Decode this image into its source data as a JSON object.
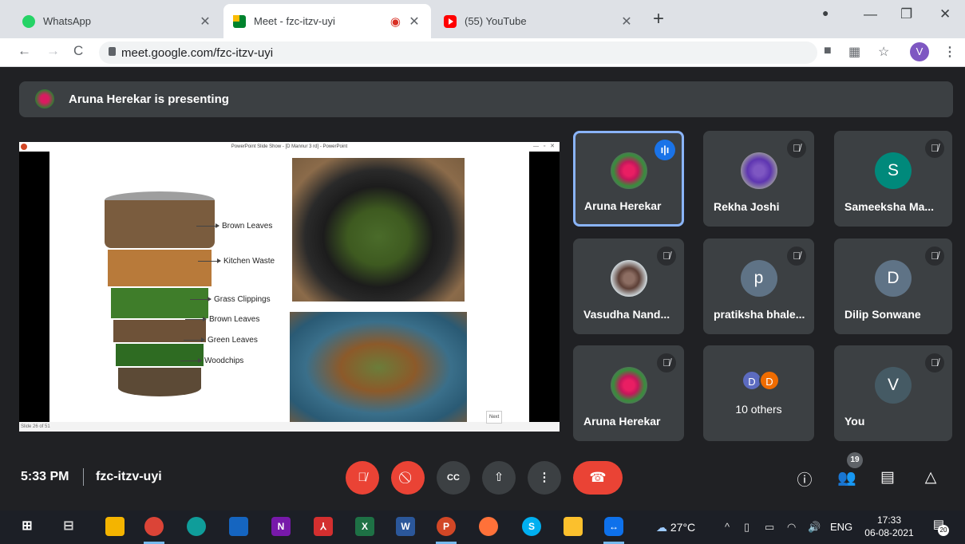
{
  "browser": {
    "tabs": [
      {
        "title": "WhatsApp",
        "active": false
      },
      {
        "title": "Meet - fzc-itzv-uyi",
        "active": true,
        "recording": true
      },
      {
        "title": "(55) YouTube",
        "active": false
      }
    ],
    "new_tab": "+",
    "url": "meet.google.com/fzc-itzv-uyi",
    "profile_initial": "V"
  },
  "meet": {
    "presenting_banner": "Aruna Herekar is presenting",
    "clock": "5:33 PM",
    "meeting_code": "fzc-itzv-uyi",
    "participant_count": "19",
    "participants": [
      {
        "name": "Aruna Herekar",
        "initial": "",
        "speaking": true,
        "muted": false,
        "avatar": "flower"
      },
      {
        "name": "Rekha Joshi",
        "initial": "",
        "speaking": false,
        "muted": true,
        "avatar": "photo"
      },
      {
        "name": "Sameeksha Ma...",
        "initial": "S",
        "speaking": false,
        "muted": true,
        "color": "#00897b"
      },
      {
        "name": "Vasudha Nand...",
        "initial": "",
        "speaking": false,
        "muted": true,
        "avatar": "photo"
      },
      {
        "name": "pratiksha bhale...",
        "initial": "p",
        "speaking": false,
        "muted": true,
        "color": "#5f7386"
      },
      {
        "name": "Dilip Sonwane",
        "initial": "D",
        "speaking": false,
        "muted": true,
        "color": "#5f7386"
      },
      {
        "name": "Aruna Herekar",
        "initial": "",
        "speaking": false,
        "muted": true,
        "avatar": "flower"
      },
      {
        "name": "10 others",
        "initial": "",
        "speaking": false,
        "muted": false,
        "others": [
          "D",
          "D"
        ]
      },
      {
        "name": "You",
        "initial": "V",
        "speaking": false,
        "muted": true,
        "color": "#455a64"
      }
    ]
  },
  "slide": {
    "window_title": "PowerPoint Slide Show - [D Mannur 3 rd] - PowerPoint",
    "status": "Slide 26 of 51",
    "next_label": "Next",
    "layers": [
      "Brown Leaves",
      "Kitchen Waste",
      "Grass Clippings",
      "Brown Leaves",
      "Green Leaves",
      "Woodchips"
    ]
  },
  "taskbar": {
    "temperature": "27°C",
    "language": "ENG",
    "time": "17:33",
    "date": "06-08-2021",
    "notifications": "20"
  },
  "colors": {
    "meet_bg": "#202124",
    "tile_bg": "#3c4043",
    "danger": "#ea4335",
    "speaking_border": "#8ab4f8",
    "accent_blue": "#1a73e8"
  }
}
